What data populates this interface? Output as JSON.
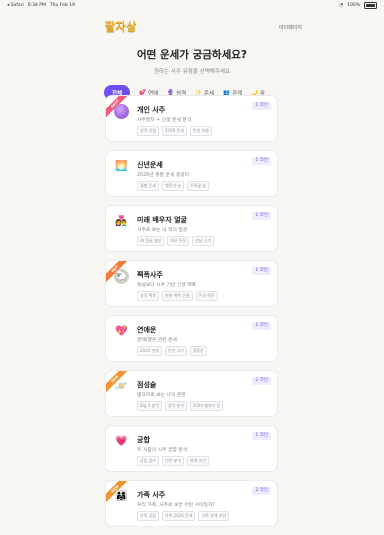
{
  "statusbar": {
    "carrier": "◂ Safari",
    "time": "6:34 PM",
    "date": "Thu Feb 19",
    "battery": "100%"
  },
  "header": {
    "logo": "팔자상",
    "mypage": "마이페이지"
  },
  "main": {
    "title": "어떤 운세가 궁금하세요?",
    "subtitle": "원하는 사주 유형을 선택해주세요"
  },
  "tabs": [
    {
      "label": "전체",
      "icon": "",
      "active": true
    },
    {
      "label": "연애",
      "icon": "💕"
    },
    {
      "label": "성격",
      "icon": "🔮"
    },
    {
      "label": "운세",
      "icon": "✨"
    },
    {
      "label": "관계",
      "icon": "👥"
    },
    {
      "label": "꿈",
      "icon": "🌙"
    }
  ],
  "cards": [
    {
      "name": "개인 사주",
      "desc": "사주팔자 + 인생 운세 분석",
      "tags": [
        "성격 기질",
        "2026 운세",
        "인생 흐름"
      ],
      "badge": "1 코인",
      "ribbon": "BEST",
      "icon": "🔮"
    },
    {
      "name": "신년운세",
      "desc": "2026년 월별 운세 총정리",
      "tags": [
        "월별 운세",
        "행운의 날",
        "주의할 날"
      ],
      "badge": "1 코인",
      "ribbon": "",
      "icon": "🌅"
    },
    {
      "name": "미래 배우자 얼굴",
      "desc": "사주로 보는 내 짝의 얼굴",
      "tags": [
        "AI 얼굴 생성",
        "외모 특징",
        "만남 시기"
      ],
      "badge": "1 코인",
      "ribbon": "",
      "icon": "👩‍❤️‍👨"
    },
    {
      "name": "팩폭사주",
      "desc": "독설보다 사주 기반 인생 팩폭",
      "tags": [
        "성격 팩폭",
        "연애 팩폭 연결",
        "돈과 팩폭"
      ],
      "badge": "1 코인",
      "ribbon": "HOT",
      "icon": "🐑"
    },
    {
      "name": "연애운",
      "desc": "연애/결혼 관련 운세",
      "tags": [
        "2026 연애",
        "인연 시기",
        "결혼운"
      ],
      "badge": "1 코인",
      "ribbon": "",
      "icon": "💖"
    },
    {
      "name": "점성술",
      "desc": "별자리로 보는 나의 운명",
      "tags": [
        "Big 3 분석",
        "성격 분석",
        "2026 별자리 운"
      ],
      "badge": "2 코인",
      "ribbon": "NEW",
      "icon": "🪐"
    },
    {
      "name": "궁합",
      "desc": "두 사람의 사주 궁합 분석",
      "tags": [
        "궁합 점수",
        "인연 분석",
        "관계 조언"
      ],
      "badge": "1 코인",
      "ribbon": "",
      "icon": "💗"
    },
    {
      "name": "가족 사주",
      "desc": "우리 가족, 사주로 보면 어떤 사이일까?",
      "tags": [
        "가족 궁합",
        "가족 2026 운세",
        "가족 관계 조언"
      ],
      "badge": "2 코인",
      "ribbon": "NEW",
      "icon": "👨‍👩‍👧"
    }
  ]
}
